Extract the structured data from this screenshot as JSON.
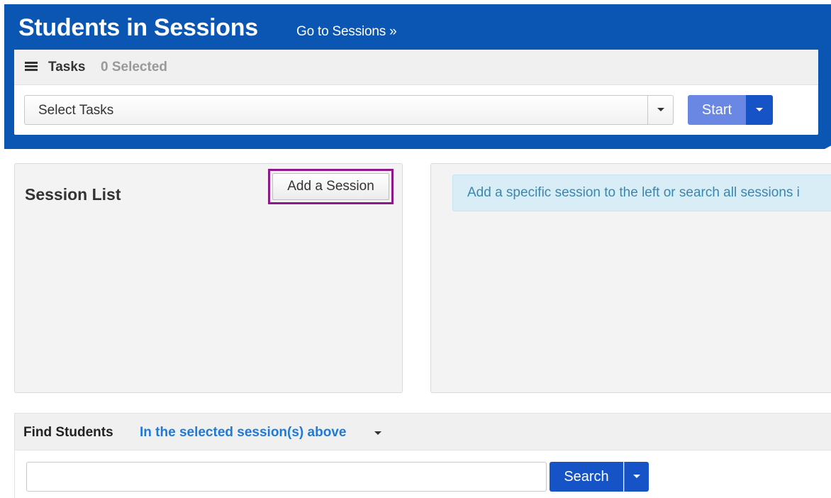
{
  "header": {
    "title": "Students in Sessions",
    "goto_link": "Go to Sessions »",
    "bg_color": "#0b56b3"
  },
  "tasks": {
    "icon": "list-icon",
    "label": "Tasks",
    "selected_count": "0 Selected",
    "select": {
      "selected_value": "Select Tasks",
      "caret_icon": "chevron-down-icon"
    },
    "start_label": "Start",
    "start_caret_icon": "chevron-down-icon"
  },
  "session_list": {
    "title": "Session List",
    "add_button": "Add a Session",
    "highlight_color": "#8e1a8a"
  },
  "info_panel": {
    "message": "Add a specific session to the left or search all sessions i"
  },
  "find_students": {
    "label": "Find Students",
    "scope": "In the selected session(s) above",
    "search_input": {
      "value": "",
      "placeholder": ""
    },
    "search_label": "Search",
    "search_caret_icon": "chevron-down-icon"
  }
}
